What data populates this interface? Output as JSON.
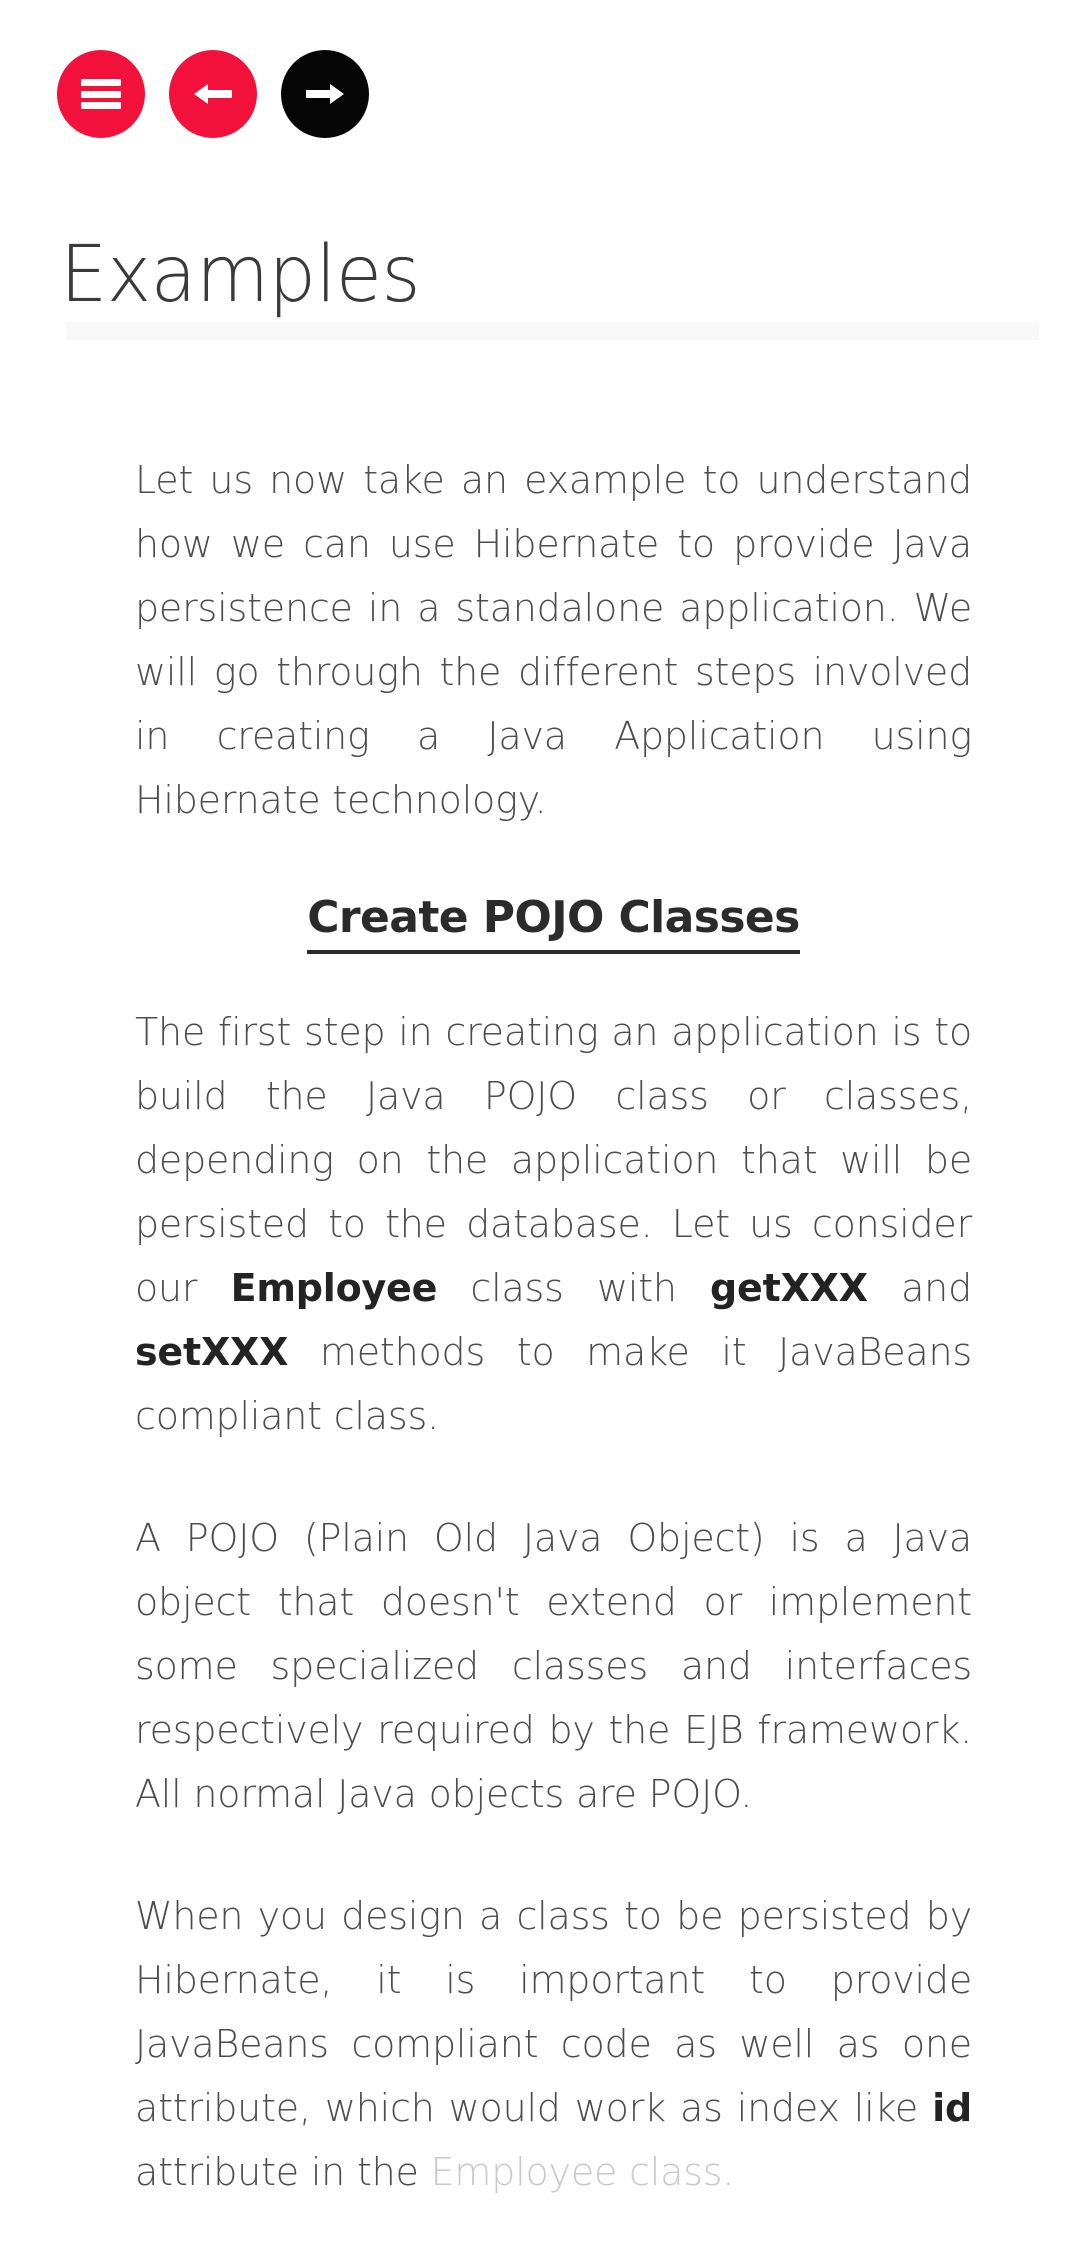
{
  "theme": {
    "accent_red": "#F2113A",
    "accent_black": "#050505",
    "body_text": "#4c4c4c",
    "heading_text": "#2b2b2b",
    "title_text": "#3a3a3a",
    "divider_bar": "#F8F8F9",
    "faded_text": "#c9c9c9",
    "background": "#ffffff"
  },
  "toolbar": {
    "menu_button": {
      "icon": "hamburger-menu-icon",
      "label": "Menu",
      "color": "#F2113A"
    },
    "previous_button": {
      "icon": "arrow-left-icon",
      "label": "Previous",
      "glyph": "←",
      "color": "#F2113A"
    },
    "next_button": {
      "icon": "arrow-right-icon",
      "label": "Next",
      "glyph": "→",
      "color": "#050505"
    }
  },
  "header": {
    "title": "Examples"
  },
  "main": {
    "paragraphs": [
      {
        "id": "intro",
        "runs": [
          {
            "text": "Let us now take an example to understand how we can use Hibernate to provide Java persistence in a standalone application. We will go through the different steps involved in creating a Java Application using Hibernate technology.",
            "bold": false
          }
        ]
      }
    ],
    "section_heading": "Create POJO Classes",
    "body": [
      {
        "id": "first-step",
        "runs": [
          {
            "text": "The first step in creating an application is to build the Java POJO class or classes, depending on the application that will be persisted to the database. Let us consider our ",
            "bold": false
          },
          {
            "text": "Employee",
            "bold": true
          },
          {
            "text": " class with ",
            "bold": false
          },
          {
            "text": "getXXX",
            "bold": true
          },
          {
            "text": " and ",
            "bold": false
          },
          {
            "text": "setXXX",
            "bold": true
          },
          {
            "text": " methods to make it JavaBeans compliant class.",
            "bold": false
          }
        ]
      },
      {
        "id": "pojo-definition",
        "runs": [
          {
            "text": "A POJO (Plain Old Java Object) is a Java object that doesn't extend or implement some specialized classes and interfaces respectively required by the EJB framework. All normal Java objects are POJO.",
            "bold": false
          }
        ]
      },
      {
        "id": "design-class",
        "runs": [
          {
            "text": "When you design a class to be persisted by Hibernate, it is important to provide JavaBeans compliant code as well as one attribute, which would work as index like ",
            "bold": false
          },
          {
            "text": "id",
            "bold": true
          },
          {
            "text": " attribute in the ",
            "bold": false
          },
          {
            "text": "Employee class.",
            "bold": false,
            "faded": true
          }
        ]
      }
    ]
  }
}
